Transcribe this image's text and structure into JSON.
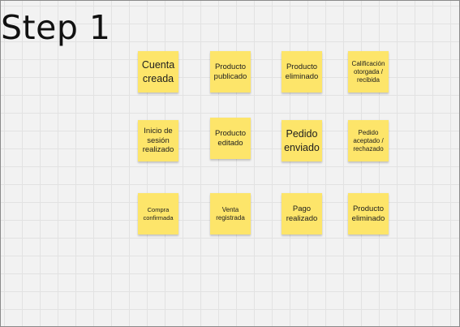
{
  "board": {
    "title": "Step 1"
  },
  "notes": [
    {
      "text": "Cuenta\ncreada"
    },
    {
      "text": "Producto\npublicado"
    },
    {
      "text": "Producto\neliminado"
    },
    {
      "text": "Calificación\notorgada /\nrecibida"
    },
    {
      "text": "Inicio de\nsesión\nrealizado"
    },
    {
      "text": "Producto\neditado"
    },
    {
      "text": "Pedido\nenviado"
    },
    {
      "text": "Pedido\naceptado /\nrechazado"
    },
    {
      "text": "Compra\nconfirmada"
    },
    {
      "text": "Venta\nregistrada"
    },
    {
      "text": "Pago\nrealizado"
    },
    {
      "text": "Producto\neliminado"
    }
  ],
  "colors": {
    "sticky": "#fde56a",
    "canvas": "#f2f2f2",
    "grid": "#e2e2e2"
  }
}
